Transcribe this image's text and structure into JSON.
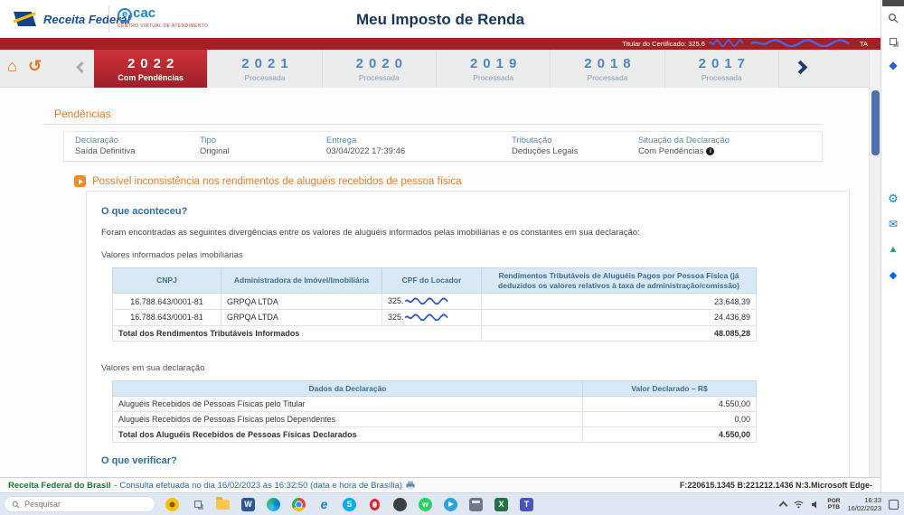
{
  "header": {
    "logo_text": "Receita Federal",
    "ecac_e": "e",
    "ecac_cac": "cac",
    "ecac_sub": "CENTRO VIRTUAL DE ATENDIMENTO",
    "title": "Meu Imposto de Renda",
    "cert_label": "Titular do Certificado: 325.6",
    "cert_suffix": "TA"
  },
  "tabs": [
    {
      "year": "2022",
      "status": "Com Pendências"
    },
    {
      "year": "2021",
      "status": "Processada"
    },
    {
      "year": "2020",
      "status": "Processada"
    },
    {
      "year": "2019",
      "status": "Processada"
    },
    {
      "year": "2018",
      "status": "Processada"
    },
    {
      "year": "2017",
      "status": "Processada"
    }
  ],
  "pendencias": {
    "title": "Pendências",
    "declaration": [
      {
        "label": "Declaração",
        "value": "Saída Definitiva"
      },
      {
        "label": "Tipo",
        "value": "Original"
      },
      {
        "label": "Entrega",
        "value": "03/04/2022 17:39:46"
      },
      {
        "label": "Tributação",
        "value": "Deduções Legais"
      },
      {
        "label": "Situação da Declaração",
        "value": "Com Pendências"
      }
    ],
    "issue_title": "Possível inconsistência nos rendimentos de aluguéis recebidos de pessoa física",
    "what_happened": "O que aconteceu?",
    "intro": "Foram encontradas as seguintes divergências entre os valores de aluguéis informados pelas imobiliárias e os constantes em sua declaração:",
    "table1_caption": "Valores informados pelas imobiliárias",
    "table1": {
      "headers": [
        "CNPJ",
        "Administradora de Imóvel/Imobiliária",
        "CPF do Locador",
        "Rendimentos Tributáveis de Aluguéis Pagos por Pessoa Física (já deduzidos os valores relativos à taxa de administração/comissão)"
      ],
      "rows": [
        {
          "cnpj": "16.788.643/0001-81",
          "admin": "GRPQA LTDA",
          "cpf": "325.",
          "valor": "23.648,39"
        },
        {
          "cnpj": "16.788.643/0001-81",
          "admin": "GRPQA LTDA",
          "cpf": "325.",
          "valor": "24.436,89"
        }
      ],
      "total_label": "Total dos Rendimentos Tributáveis Informados",
      "total_value": "48.085,28"
    },
    "table2_caption": "Valores em sua declaração",
    "table2": {
      "headers": [
        "Dados da Declaração",
        "Valor Declarado – R$"
      ],
      "rows": [
        {
          "label": "Aluguéis Recebidos de Pessoas Físicas pelo Titular",
          "valor": "4.550,00"
        },
        {
          "label": "Aluguéis Recebidos de Pessoas Físicas pelos Dependentes",
          "valor": "0,00"
        }
      ],
      "total_label": "Total dos Aluguéis Recebidos de Pessoas Físicas Declarados",
      "total_value": "4.550,00"
    },
    "what_verify": "O que verificar?"
  },
  "statusbar": {
    "brand": "Receita Federal do Brasil",
    "info": " - Consulta efetuada no dia 16/02/2023 às 16:32:50 (data e hora de Brasília)",
    "right": "F:220615.1345 B:221212.1436 N:3.Microsoft Edge-"
  },
  "taskbar": {
    "search_placeholder": "Pesquisar",
    "lang1": "POR",
    "lang2": "PTB",
    "time": "16:33",
    "date": "16/02/2023"
  },
  "icons": {
    "home": "⌂",
    "undo": "↺",
    "info": "i",
    "copilot": "◆",
    "settings": "⚙",
    "mail": "✉",
    "drive": "▲",
    "dropbox": "◆",
    "word": "W",
    "skype": "S",
    "ie": "e",
    "whatsapp": "w",
    "excel": "X",
    "teams": "T"
  }
}
